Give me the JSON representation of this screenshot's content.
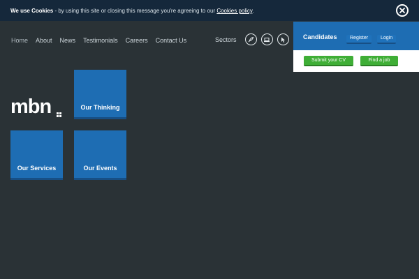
{
  "cookie_bar": {
    "bold": "We use Cookies",
    "text": " - by using this site or closing this message you're agreeing to our ",
    "link": "Cookies policy",
    "end": "."
  },
  "nav": {
    "items": [
      "Home",
      "About",
      "News",
      "Testimonials",
      "Careers",
      "Contact Us"
    ],
    "active": "Home"
  },
  "sectors": {
    "label": "Sectors",
    "icons": [
      "rocket-icon",
      "laptop-icon",
      "cursor-icon"
    ]
  },
  "candidates": {
    "title": "Candidates",
    "register": "Register",
    "login": "Login",
    "submit_cv": "Submit your CV",
    "find_job": "Find a job"
  },
  "logo": {
    "text": "mbn"
  },
  "tiles": {
    "thinking": "Our Thinking",
    "services": "Our Services",
    "events": "Our Events"
  },
  "colors": {
    "background": "#2a3236",
    "cookie_bar": "#15283b",
    "brand_blue": "#1e6db3",
    "green": "#3fae36"
  }
}
